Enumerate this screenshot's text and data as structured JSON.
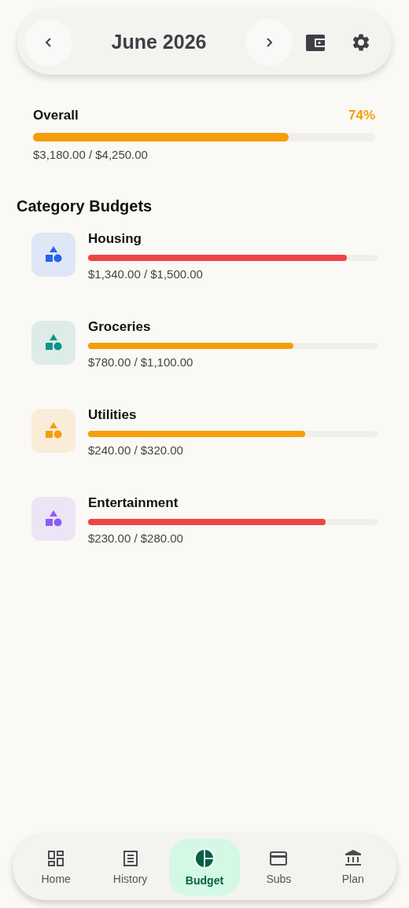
{
  "header": {
    "month": "June 2026"
  },
  "overall": {
    "label": "Overall",
    "percent": "74%",
    "level": 0.748,
    "amount": "$3,180.00 / $4,250.00"
  },
  "section_title": "Category Budgets",
  "categories": [
    {
      "name": "Housing",
      "level": 0.893,
      "amount": "$1,340.00 / $1,500.00",
      "color": "#2563eb"
    },
    {
      "name": "Groceries",
      "level": 0.709,
      "amount": "$780.00 / $1,100.00",
      "color": "#0d9488"
    },
    {
      "name": "Utilities",
      "level": 0.75,
      "amount": "$240.00 / $320.00",
      "color": "#f59e0b"
    },
    {
      "name": "Entertainment",
      "level": 0.821,
      "amount": "$230.00 / $280.00",
      "color": "#8b5cf6"
    }
  ],
  "nav": [
    {
      "kind": "home",
      "label": "Home",
      "selected": false
    },
    {
      "kind": "history",
      "label": "History",
      "selected": false
    },
    {
      "kind": "budget",
      "label": "Budget",
      "selected": true
    },
    {
      "kind": "subs",
      "label": "Subs",
      "selected": false
    },
    {
      "kind": "plan",
      "label": "Plan",
      "selected": false
    }
  ]
}
